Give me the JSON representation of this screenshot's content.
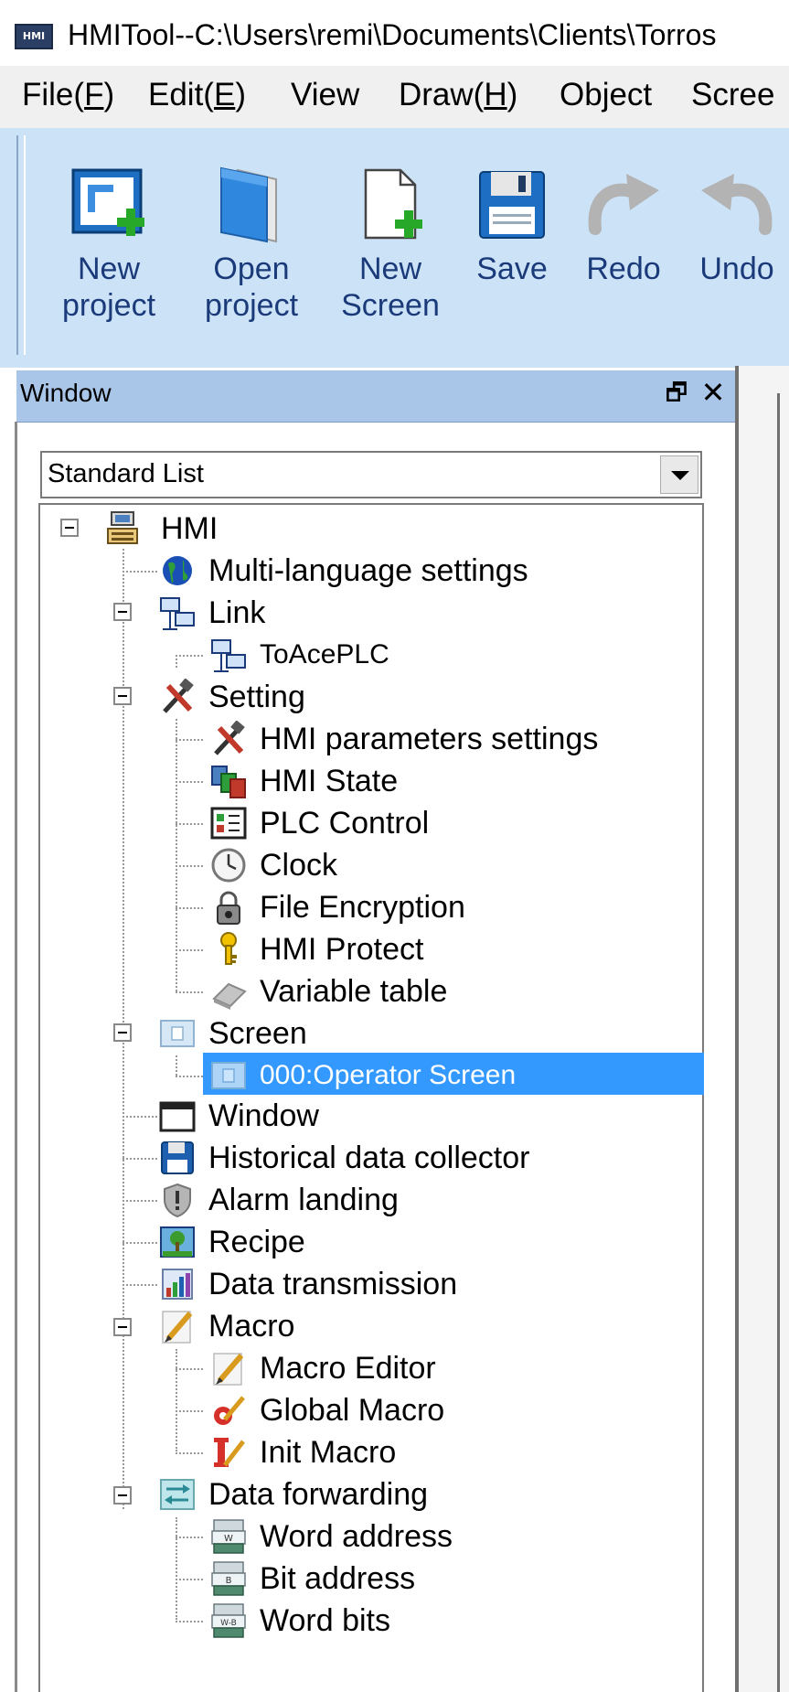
{
  "window": {
    "logo_text": "HMI",
    "title": "HMITool--C:\\Users\\remi\\Documents\\Clients\\Torros"
  },
  "menu": {
    "items": [
      {
        "label": "File(",
        "key": "F",
        "tail": ")"
      },
      {
        "label": "Edit(",
        "key": "E",
        "tail": ")"
      },
      {
        "label": "View",
        "key": "",
        "tail": ""
      },
      {
        "label": "Draw(",
        "key": "H",
        "tail": ")"
      },
      {
        "label": "Object",
        "key": "",
        "tail": ""
      },
      {
        "label": "Scree",
        "key": "",
        "tail": ""
      }
    ]
  },
  "toolbar": {
    "buttons": [
      {
        "icon": "new-project-icon",
        "line1": "New",
        "line2": "project"
      },
      {
        "icon": "open-project-icon",
        "line1": "Open",
        "line2": "project"
      },
      {
        "icon": "new-screen-icon",
        "line1": "New",
        "line2": "Screen"
      },
      {
        "icon": "save-icon",
        "line1": "",
        "line2": "Save"
      },
      {
        "icon": "redo-icon",
        "line1": "",
        "line2": "Redo"
      },
      {
        "icon": "undo-icon",
        "line1": "",
        "line2": "Undo"
      }
    ]
  },
  "pane": {
    "title": "Window",
    "float_glyph": "🗗",
    "close_glyph": "✕",
    "combo_value": "Standard List"
  },
  "tree": {
    "root": "HMI",
    "items": [
      {
        "id": "multilang",
        "label": "Multi-language settings",
        "icon": "globe-icon"
      },
      {
        "id": "link",
        "label": "Link",
        "icon": "network-icon"
      },
      {
        "id": "toaceplc",
        "label": "ToAcePLC",
        "icon": "network-icon"
      },
      {
        "id": "setting",
        "label": "Setting",
        "icon": "tools-icon"
      },
      {
        "id": "hmi-params",
        "label": "HMI parameters settings",
        "icon": "tools-icon"
      },
      {
        "id": "hmi-state",
        "label": "HMI State",
        "icon": "state-icon"
      },
      {
        "id": "plc-control",
        "label": "PLC Control",
        "icon": "plc-control-icon"
      },
      {
        "id": "clock",
        "label": "Clock",
        "icon": "clock-icon"
      },
      {
        "id": "file-encryption",
        "label": "File Encryption",
        "icon": "padlock-icon"
      },
      {
        "id": "hmi-protect",
        "label": "HMI Protect",
        "icon": "key-icon"
      },
      {
        "id": "variable-table",
        "label": "Variable table",
        "icon": "eraser-icon"
      },
      {
        "id": "screen",
        "label": "Screen",
        "icon": "screen-icon"
      },
      {
        "id": "operator-screen",
        "label": "000:Operator Screen",
        "icon": "screen-icon"
      },
      {
        "id": "window",
        "label": "Window",
        "icon": "window-icon"
      },
      {
        "id": "historical",
        "label": "Historical data collector",
        "icon": "floppy-icon"
      },
      {
        "id": "alarm",
        "label": "Alarm landing",
        "icon": "shield-icon"
      },
      {
        "id": "recipe",
        "label": "Recipe",
        "icon": "recipe-icon"
      },
      {
        "id": "data-transmission",
        "label": "Data transmission",
        "icon": "chart-icon"
      },
      {
        "id": "macro",
        "label": "Macro",
        "icon": "pencil-icon"
      },
      {
        "id": "macro-editor",
        "label": "Macro Editor",
        "icon": "pencil-icon"
      },
      {
        "id": "global-macro",
        "label": "Global Macro",
        "icon": "global-macro-icon"
      },
      {
        "id": "init-macro",
        "label": "Init Macro",
        "icon": "init-macro-icon"
      },
      {
        "id": "data-forwarding",
        "label": "Data forwarding",
        "icon": "forwarding-icon"
      },
      {
        "id": "word-address",
        "label": "Word address",
        "icon": "word-address-icon",
        "badge": "W"
      },
      {
        "id": "bit-address",
        "label": "Bit address",
        "icon": "bit-address-icon",
        "badge": "B"
      },
      {
        "id": "word-bits",
        "label": "Word bits",
        "icon": "word-bits-icon",
        "badge": "W-B"
      }
    ],
    "selected": "operator-screen"
  },
  "colors": {
    "toolbar_bg": "#cce2f7",
    "pane_header_bg": "#a9c6e8",
    "selection": "#3399ff",
    "toolbar_text": "#1a3a7a"
  }
}
